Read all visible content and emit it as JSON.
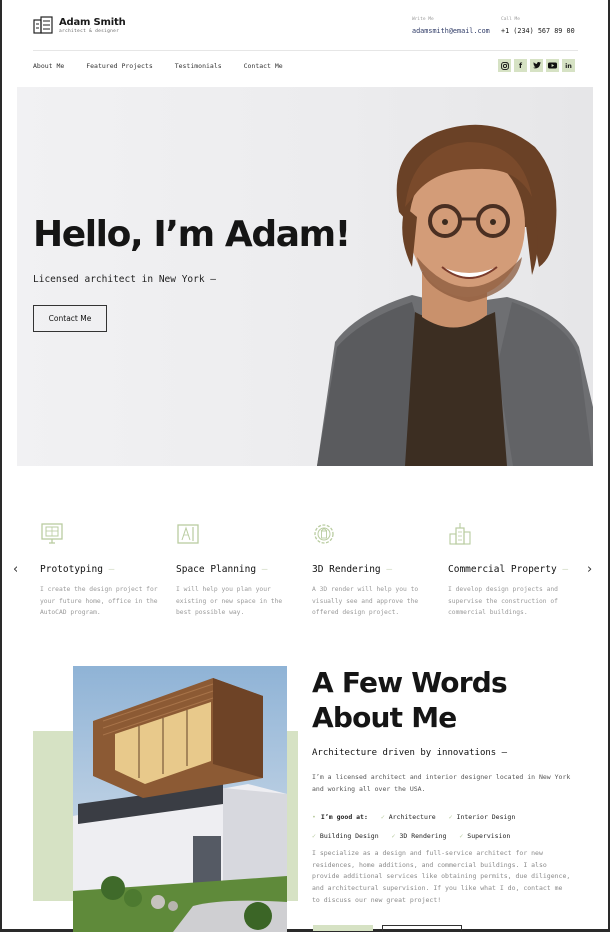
{
  "header": {
    "brand_name": "Adam Smith",
    "brand_tagline": "architect & designer",
    "email_label": "Write Me",
    "email_value": "adamsmith@email.com",
    "phone_label": "Call Me",
    "phone_value": "+1 (234) 567 89 00"
  },
  "nav": {
    "items": [
      "About Me",
      "Featured Projects",
      "Testimonials",
      "Contact Me"
    ]
  },
  "socials": [
    "instagram-icon",
    "facebook-icon",
    "twitter-icon",
    "youtube-icon",
    "linkedin-icon"
  ],
  "hero": {
    "title": "Hello, I’m Adam!",
    "subtitle": "Licensed architect in New York —",
    "button_label": "Contact Me"
  },
  "services": [
    {
      "icon": "monitor-blueprint-icon",
      "title": "Prototyping",
      "desc": "I create the design project for your future home, office in the AutoCAD program."
    },
    {
      "icon": "drafting-tools-icon",
      "title": "Space Planning",
      "desc": "I will help you plan your existing or new space in the best possible way."
    },
    {
      "icon": "gear-building-icon",
      "title": "3D Rendering",
      "desc": "A 3D render will help you to visually see and approve the offered design project."
    },
    {
      "icon": "tower-building-icon",
      "title": "Commercial Property",
      "desc": "I develop design projects and supervise the construction of commercial buildings."
    }
  ],
  "about": {
    "title_line1": "A Few Words",
    "title_line2": "About Me",
    "subtitle": "Architecture driven by innovations —",
    "intro": "I’m a licensed architect and interior designer located in New York and working all over the USA.",
    "skills_lead": "I’m good at:",
    "skills": [
      "Architecture",
      "Interior Design",
      "Building Design",
      "3D Rendering",
      "Supervision"
    ],
    "body": "I specialize as a design and full-service architect for new residences, home additions, and commercial buildings. I also provide additional services like obtaining permits, due diligence, and architectural supervision. If you like what I do, contact me to discuss our new great project!"
  },
  "colors": {
    "accent_green": "#d6e2c4",
    "text_dark": "#151515",
    "link_blue": "#2e3a66"
  }
}
